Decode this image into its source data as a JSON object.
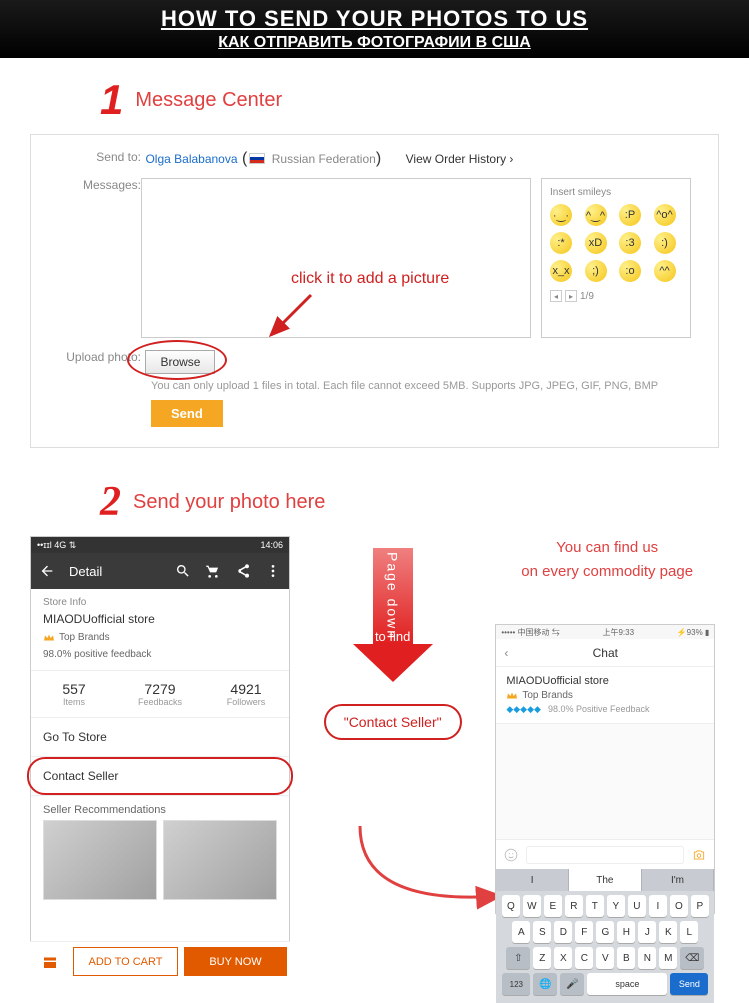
{
  "header": {
    "title_en": "HOW TO SEND YOUR PHOTOS TO US",
    "title_ru": "КАК ОТПРАВИТЬ ФОТОГРАФИИ В США"
  },
  "step1": {
    "num": "1",
    "title": "Message Center",
    "sendto_label": "Send to:",
    "recipient_name": "Olga Balabanova",
    "recipient_country": "Russian Federation",
    "view_history": "View Order History ›",
    "messages_label": "Messages:",
    "smileys_title": "Insert smileys",
    "pager": "1/9",
    "annotation": "click it to add a picture",
    "upload_label": "Upload photo:",
    "browse_btn": "Browse",
    "upload_hint": "You can only upload 1 files in total. Each file cannot exceed 5MB. Supports JPG, JPEG, GIF, PNG, BMP",
    "send_btn": "Send"
  },
  "step2": {
    "num": "2",
    "title": "Send your photo here",
    "page_down": "Page down",
    "to_find": "to find",
    "contact_seller_quoted": "\"Contact Seller\"",
    "find_us_line1": "You can find us",
    "find_us_line2": "on every commodity page"
  },
  "phone1": {
    "status_left": "4G",
    "status_time": "14:06",
    "appbar_title": "Detail",
    "store_info_label": "Store Info",
    "store_name": "MIAODUofficial store",
    "top_brands": "Top Brands",
    "feedback": "98.0% positive feedback",
    "stats": [
      {
        "num": "557",
        "lbl": "Items"
      },
      {
        "num": "7279",
        "lbl": "Feedbacks"
      },
      {
        "num": "4921",
        "lbl": "Followers"
      }
    ],
    "go_to_store": "Go To Store",
    "contact_seller": "Contact Seller",
    "seller_rec": "Seller Recommendations",
    "add_cart": "ADD TO CART",
    "buy_now": "BUY NOW"
  },
  "phone2": {
    "carrier": "中国移动",
    "time": "上午9:33",
    "title": "Chat",
    "store_name": "MIAODUofficial store",
    "top_brands": "Top Brands",
    "pos_feedback": "98.0% Positive Feedback",
    "suggestions": [
      "I",
      "The",
      "I'm"
    ],
    "kb_row1": [
      "Q",
      "W",
      "E",
      "R",
      "T",
      "Y",
      "U",
      "I",
      "O",
      "P"
    ],
    "kb_row2": [
      "A",
      "S",
      "D",
      "F",
      "G",
      "H",
      "J",
      "K",
      "L"
    ],
    "kb_row3": [
      "Z",
      "X",
      "C",
      "V",
      "B",
      "N",
      "M"
    ],
    "key_123": "123",
    "key_space": "space",
    "key_send": "Send"
  }
}
